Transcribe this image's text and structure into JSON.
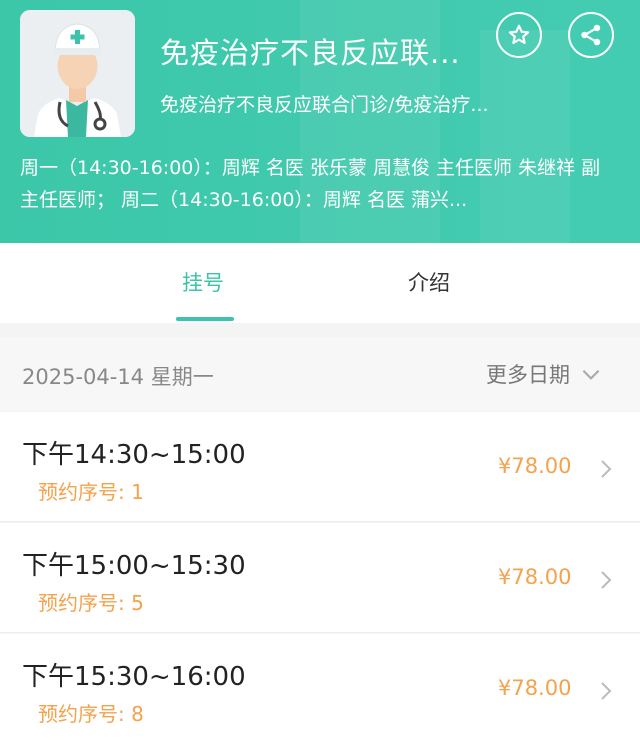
{
  "header": {
    "title": "免疫治疗不良反应联...",
    "subtitle": "免疫治疗不良反应联合门诊/免疫治疗...",
    "schedule": "周一（14:30-16:00）：周辉 名医 张乐蒙 周慧俊 主任医师 朱继祥 副主任医师； 周二（14:30-16:00）：周辉 名医 蒲兴...",
    "avatar_icon": "doctor-avatar-icon",
    "favorite_icon": "star-icon",
    "share_icon": "share-icon"
  },
  "tabs": [
    {
      "label": "挂号",
      "active": true
    },
    {
      "label": "介绍",
      "active": false
    }
  ],
  "date_bar": {
    "date": "2025-04-14 星期一",
    "more_label": "更多日期",
    "more_icon": "chevron-down-icon"
  },
  "slots": [
    {
      "time": "下午14:30~15:00",
      "number": "预约序号: 1",
      "price": "¥78.00"
    },
    {
      "time": "下午15:00~15:30",
      "number": "预约序号: 5",
      "price": "¥78.00"
    },
    {
      "time": "下午15:30~16:00",
      "number": "预约序号: 8",
      "price": "¥78.00"
    }
  ],
  "colors": {
    "header_bg": "#3cc7a9",
    "accent": "#3cc3ab",
    "price": "#f4a24c"
  }
}
